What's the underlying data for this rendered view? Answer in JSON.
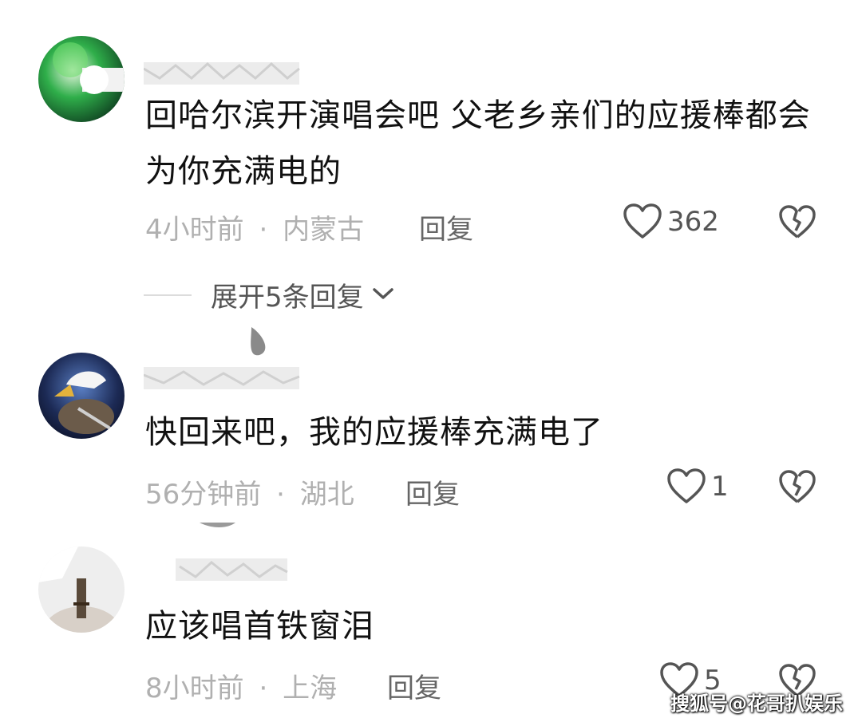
{
  "comments": [
    {
      "text": "回哈尔滨开演唱会吧 父老乡亲们的应援棒都会为你充满电的",
      "time": "4小时前",
      "separator": "·",
      "location": "内蒙古",
      "reply_label": "回复",
      "likes": "362"
    },
    {
      "text": "快回来吧，我的应援棒充满电了",
      "time": "56分钟前",
      "separator": "·",
      "location": "湖北",
      "reply_label": "回复",
      "likes": "1"
    },
    {
      "text": "应该唱首铁窗泪",
      "time": "8小时前",
      "separator": "·",
      "location": "上海",
      "reply_label": "回复",
      "likes": "5"
    }
  ],
  "expand_replies": {
    "label": "展开5条回复"
  },
  "watermark": "搜狐号@花哥扒娱乐",
  "icons": {
    "like": "heart-outline-icon",
    "dislike": "broken-heart-icon",
    "expand": "chevron-down-icon"
  },
  "colors": {
    "text": "#111111",
    "meta": "#b0b0b0",
    "reply": "#666666",
    "icon": "#555555"
  }
}
